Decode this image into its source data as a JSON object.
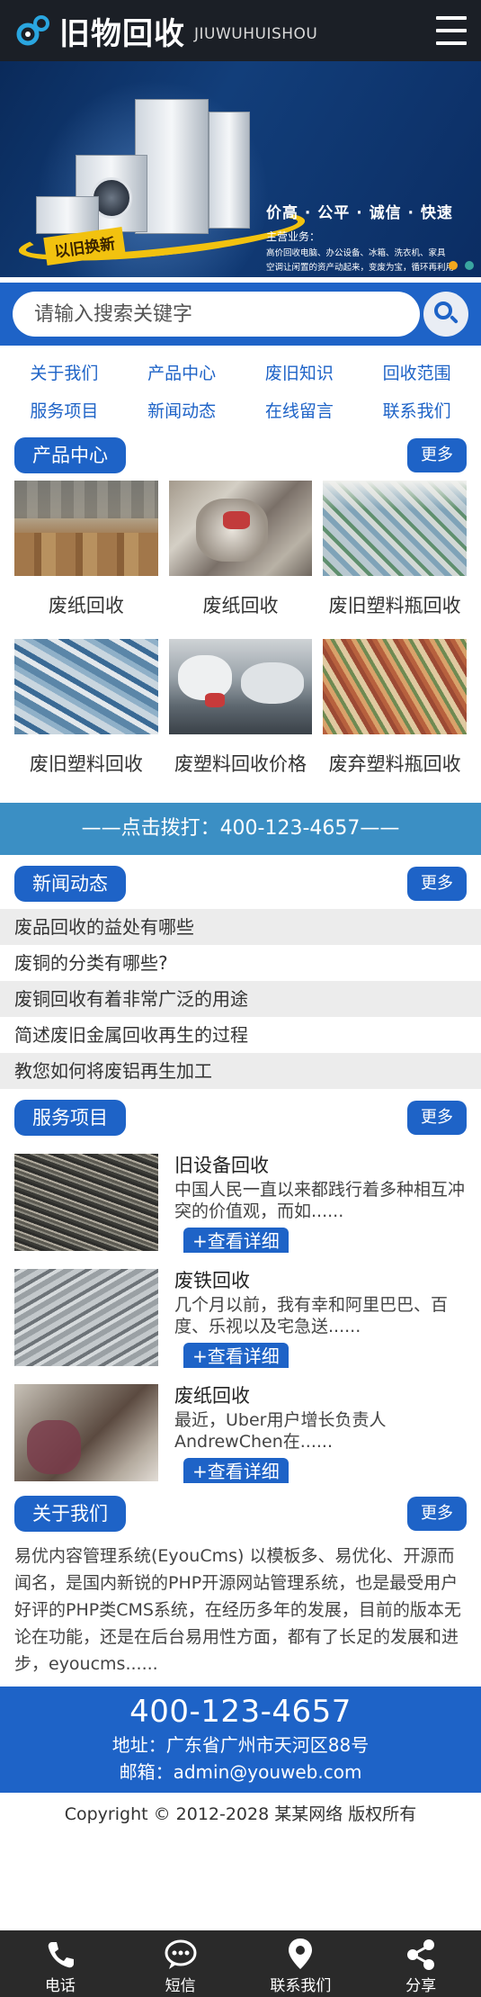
{
  "header": {
    "logo_text": "旧物回收",
    "logo_sub": "JIUWUHUISHOU"
  },
  "banner": {
    "tag": "以旧换新",
    "title": "价高 · 公平 · 诚信 · 快速",
    "desc_heading": "主营业务：",
    "desc_line1": "高价回收电脑、办公设备、冰箱、洗衣机、家具",
    "desc_line2": "空调让闲置的资产动起来，变废为宝，循环再利用",
    "dot_colors": [
      "#f2a81d",
      "#3aa6a0"
    ]
  },
  "search": {
    "placeholder": "请输入搜索关键字"
  },
  "nav": [
    "关于我们",
    "产品中心",
    "废旧知识",
    "回收范围",
    "服务项目",
    "新闻动态",
    "在线留言",
    "联系我们"
  ],
  "products": {
    "title": "产品中心",
    "more": "更多",
    "items": [
      {
        "name": "废纸回收",
        "img": "warehouse-cartons"
      },
      {
        "name": "废纸回收",
        "img": "paper-bales"
      },
      {
        "name": "废旧塑料瓶回收",
        "img": "plastic-bottle-bales"
      },
      {
        "name": "废旧塑料回收",
        "img": "plastic-scrap"
      },
      {
        "name": "废塑料回收价格",
        "img": "plastic-bags"
      },
      {
        "name": "废弃塑料瓶回收",
        "img": "bottle-pile"
      }
    ]
  },
  "hotline": "——点击拨打：400-123-4657——",
  "news": {
    "title": "新闻动态",
    "more": "更多",
    "items": [
      "废品回收的益处有哪些",
      "废铜的分类有哪些?",
      "废铜回收有着非常广泛的用途",
      "简述废旧金属回收再生的过程",
      "教您如何将废铝再生加工"
    ]
  },
  "services": {
    "title": "服务项目",
    "more": "更多",
    "button": "+查看详细",
    "items": [
      {
        "title": "旧设备回收",
        "desc": "中国人民一直以来都践行着多种相互冲突的价值观，而如......",
        "img": "cable-scrap"
      },
      {
        "title": "废铁回收",
        "desc": "几个月以前，我有幸和阿里巴巴、百度、乐视以及宅急送......",
        "img": "metal-scrap"
      },
      {
        "title": "废纸回收",
        "desc": "最近，Uber用户增长负责人AndrewChen在......",
        "img": "paper-room"
      }
    ]
  },
  "about": {
    "title": "关于我们",
    "more": "更多",
    "text": "易优内容管理系统(EyouCms) 以模板多、易优化、开源而闻名，是国内新锐的PHP开源网站管理系统，也是最受用户好评的PHP类CMS系统，在经历多年的发展，目前的版本无论在功能，还是在后台易用性方面，都有了长足的发展和进步，eyoucms......"
  },
  "footer": {
    "phone": "400-123-4657",
    "address": "地址：广东省广州市天河区88号",
    "email": "邮箱：admin@youweb.com",
    "copyright": "Copyright © 2012-2028 某某网络 版权所有"
  },
  "tabbar": [
    {
      "label": "电话",
      "icon": "phone-icon"
    },
    {
      "label": "短信",
      "icon": "message-icon"
    },
    {
      "label": "联系我们",
      "icon": "location-icon"
    },
    {
      "label": "分享",
      "icon": "share-icon"
    }
  ],
  "colors": {
    "primary": "#1e63c7",
    "hotline": "#3b8fc4",
    "header": "#1b1f26",
    "tabbar": "#2a2a2a"
  }
}
